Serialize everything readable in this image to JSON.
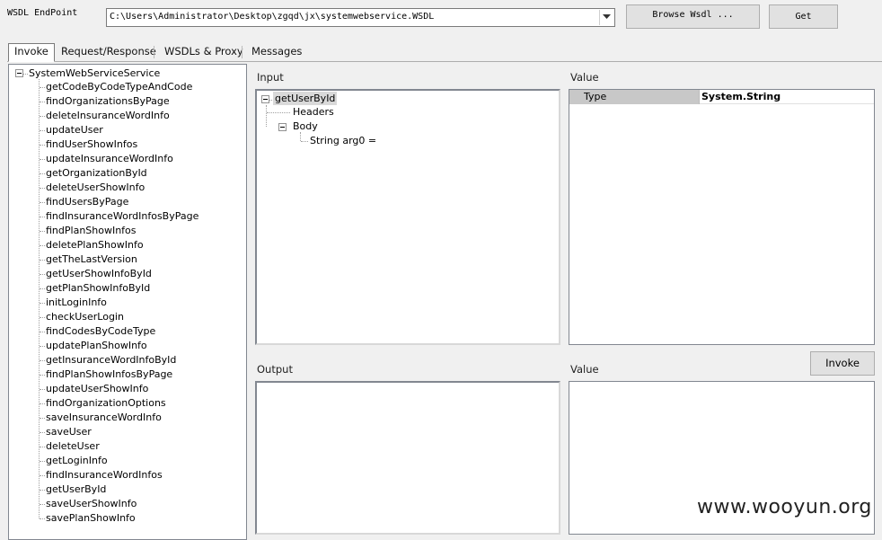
{
  "endpoint": {
    "label": "WSDL EndPoint",
    "value": "C:\\Users\\Administrator\\Desktop\\zgqd\\jx\\systemwebservice.WSDL"
  },
  "buttons": {
    "browse": "Browse Wsdl ...",
    "get": "Get",
    "invoke": "Invoke"
  },
  "tabs": [
    "Invoke",
    "Request/Response",
    "WSDLs & Proxy",
    "Messages"
  ],
  "service_tree": {
    "root": "SystemWebServiceService",
    "methods": [
      "getCodeByCodeTypeAndCode",
      "findOrganizationsByPage",
      "deleteInsuranceWordInfo",
      "updateUser",
      "findUserShowInfos",
      "updateInsuranceWordInfo",
      "getOrganizationById",
      "deleteUserShowInfo",
      "findUsersByPage",
      "findInsuranceWordInfosByPage",
      "findPlanShowInfos",
      "deletePlanShowInfo",
      "getTheLastVersion",
      "getUserShowInfoById",
      "getPlanShowInfoById",
      "initLoginInfo",
      "checkUserLogin",
      "findCodesByCodeType",
      "updatePlanShowInfo",
      "getInsuranceWordInfoById",
      "findPlanShowInfosByPage",
      "updateUserShowInfo",
      "findOrganizationOptions",
      "saveInsuranceWordInfo",
      "saveUser",
      "deleteUser",
      "getLoginInfo",
      "findInsuranceWordInfos",
      "getUserById",
      "saveUserShowInfo",
      "savePlanShowInfo"
    ]
  },
  "input": {
    "label": "Input",
    "tree": {
      "method": "getUserById",
      "headers": "Headers",
      "body": "Body",
      "param": "String arg0 ="
    }
  },
  "input_value": {
    "label": "Value",
    "row_key": "Type",
    "row_value": "System.String"
  },
  "output": {
    "label": "Output"
  },
  "output_value": {
    "label": "Value"
  },
  "watermark": "www.wooyun.org"
}
